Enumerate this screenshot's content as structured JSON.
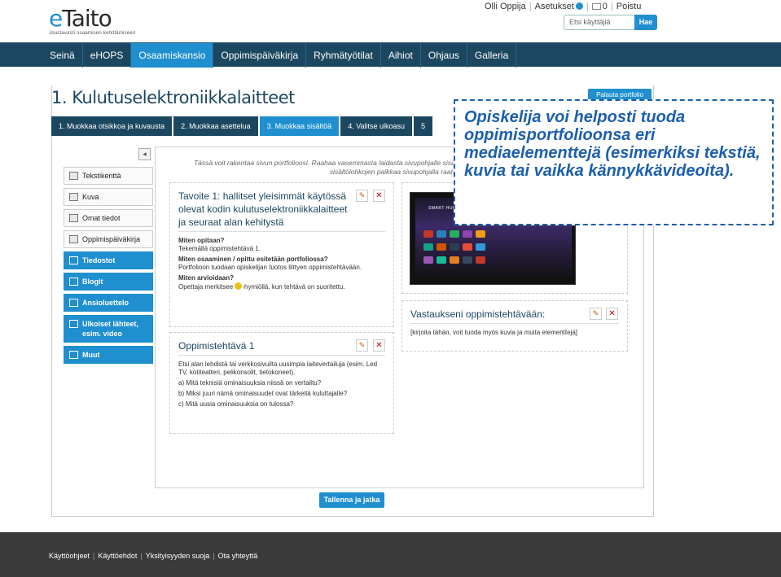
{
  "header": {
    "logo_main_accent": "e",
    "logo_main_rest": "Taito",
    "logo_sub": "Joustavasti osaamisen kehittämiseen",
    "user_name": "Olli Oppija",
    "settings_label": "Asetukset",
    "messages_count": "0",
    "logout_label": "Poistu",
    "search_placeholder": "Etsi käyttäjiä",
    "search_button": "Hae"
  },
  "nav": {
    "items": [
      "Seinä",
      "eHOPS",
      "Osaamiskansio",
      "Oppimispäiväkirja",
      "Ryhmätyötilat",
      "Aihiot",
      "Ohjaus",
      "Galleria"
    ],
    "active": "Osaamiskansio"
  },
  "page": {
    "title": "1. Kulutuselektroniikkalaitteet",
    "restore_button": "Palauta portfolio",
    "steps": [
      "1. Muokkaa otsikkoa ja kuvausta",
      "2. Muokkaa asettelua",
      "3. Muokkaa sisältöä",
      "4. Valitse ulkoasu",
      "5"
    ],
    "active_step": "3. Muokkaa sisältöä",
    "hint_line1": "Tässä voit rakentaa sivun portfolioosi. Raahaa vasemmasta laidasta sivupohjalle sisält",
    "hint_line2": "sisältölohkojen paikkaa sivupohjalla raahe"
  },
  "sidebar": {
    "items": [
      {
        "label": "Tekstikenttä",
        "style": "plain",
        "icon": "text-icon"
      },
      {
        "label": "Kuva",
        "style": "plain",
        "icon": "image-icon"
      },
      {
        "label": "Omat tiedot",
        "style": "plain",
        "icon": "user-icon"
      },
      {
        "label": "Oppimispäiväkirja",
        "style": "plain",
        "icon": "journal-icon"
      },
      {
        "label": "Tiedostot",
        "style": "blue",
        "icon": "file-icon"
      },
      {
        "label": "Blogit",
        "style": "blue",
        "icon": "pencil-icon"
      },
      {
        "label": "Ansioluettelo",
        "style": "blue",
        "icon": "cv-icon"
      },
      {
        "label": "Ulkoiset lähteet, esim. video",
        "style": "blue-tall",
        "icon": "external-link-icon"
      },
      {
        "label": "Muut",
        "style": "blue",
        "icon": "other-icon"
      }
    ]
  },
  "blocks": {
    "goal": {
      "title": "Tavoite 1: hallitset yleisimmät käytössä olevat kodin kulutuselektroniikkalaitteet ja seuraat alan kehitystä",
      "q1": "Miten opitaan?",
      "a1": "Tekemällä oppimistehtävä 1.",
      "q2": "Miten osaaminen / opittu esitetään portfoliossa?",
      "a2": "Portfolioon tuodaan opiskelijan tuotos liittyen oppimistehtävään.",
      "q3": "Miten arvioidaan?",
      "a3_pre": "Opettaja merkitsee",
      "a3_post": "-hymiöllä, kun tehtävä on suoritettu."
    },
    "task": {
      "title": "Oppimistehtävä 1",
      "intro": "Etsi alan lehdistä tai verkkosivuilta uusimpia laitevertailuja (esim. Led TV, kotiteatteri, pelikonsolit, tietokoneet).",
      "a": "a) Mitä teknisiä ominaisuuksia niissä on vertailtu?",
      "b": "b) Miksi juuri nämä ominaisuudet ovat tärkeitä kuluttajalle?",
      "c": "c) Mitä uusia ominaisuuksia on tulossa?"
    },
    "image": {
      "label": "SMART HUB"
    },
    "answer": {
      "title": "Vastaukseni oppimistehtävään:",
      "placeholder": "[kirjoita tähän, voit tuoda myös kuvia ja muita elementtejä]"
    }
  },
  "save_button": "Tallenna ja jatka",
  "footer": {
    "links": [
      "Käyttöohjeet",
      "Käyttöehdot",
      "Yksityisyyden suoja",
      "Ota yhteyttä"
    ]
  },
  "callout": {
    "text": "Opiskelija voi helposti tuoda oppimisportfolioonsa eri mediaelementtejä (esimerkiksi tekstiä, kuvia tai vaikka kännykkävideoita)."
  },
  "colors": {
    "brand_blue": "#1f8fd0",
    "nav_dark": "#1c4761",
    "callout_blue": "#1c5fae"
  }
}
